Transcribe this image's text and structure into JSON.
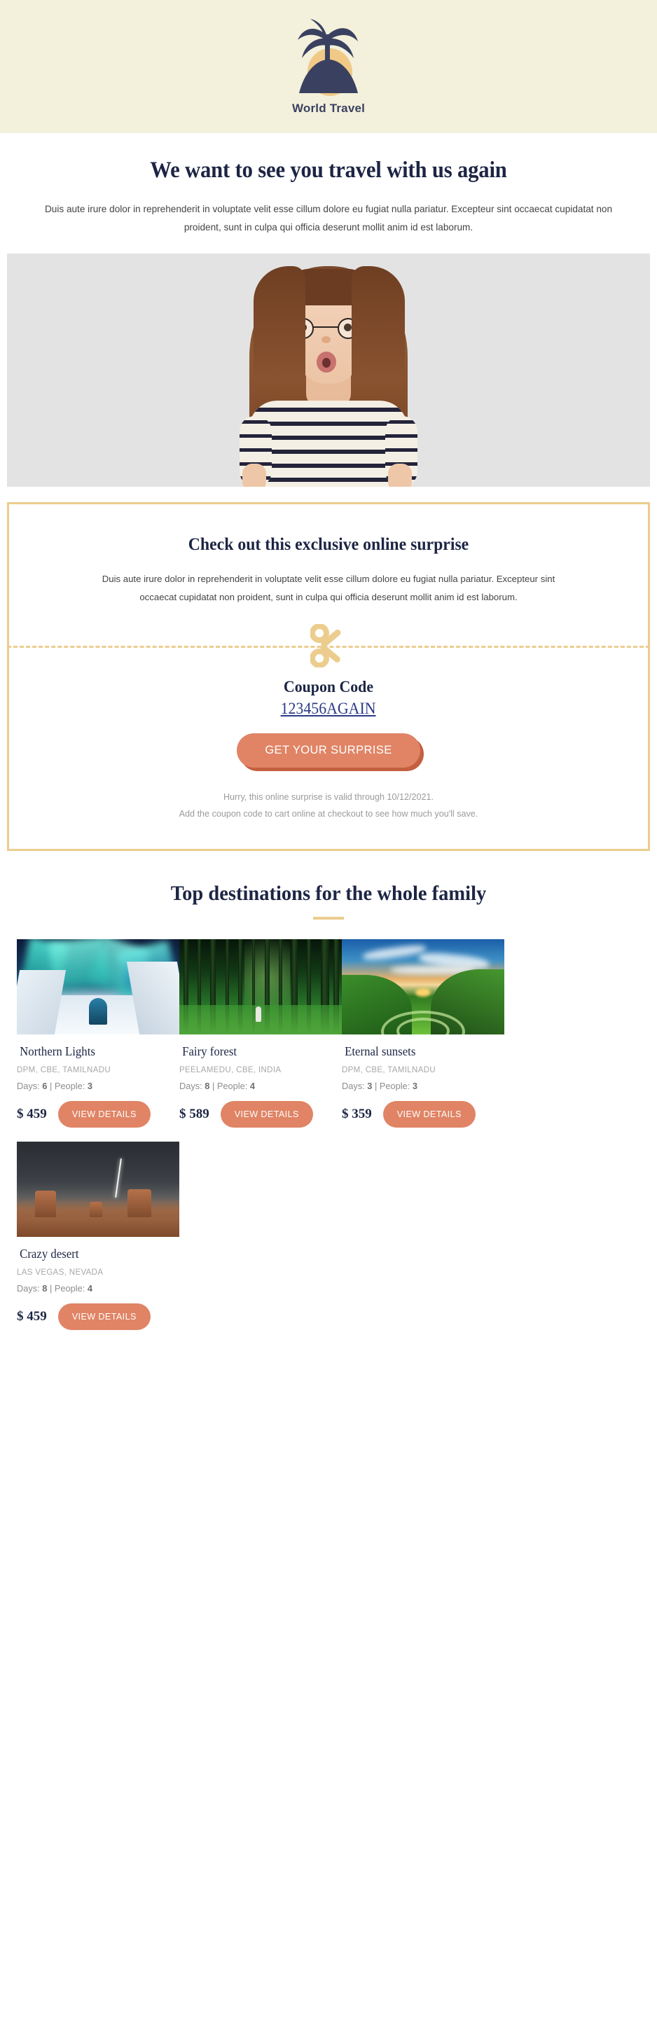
{
  "brand": {
    "name": "World Travel",
    "logo_icon": "palm-tree-island-icon",
    "header_bg": "#f3f0dc",
    "palm_color": "#3a4160",
    "sun_color": "#f0c987"
  },
  "intro": {
    "headline": "We want to see you travel with us again",
    "body": "Duis aute irure dolor in reprehenderit in voluptate velit esse cillum dolore eu fugiat nulla pariatur. Excepteur sint occaecat cupidatat non proident, sunt in culpa qui officia deserunt mollit anim id est laborum."
  },
  "hero": {
    "image_alt": "surprised-woman-pointing-down"
  },
  "coupon": {
    "title": "Check out this exclusive online surprise",
    "body": "Duis aute irure dolor in reprehenderit in voluptate velit esse cillum dolore eu fugiat nulla pariatur. Excepteur sint occaecat cupidatat non proident, sunt in culpa qui officia deserunt mollit anim id est laborum.",
    "scissors_icon": "scissors-icon",
    "code_label": "Coupon Code",
    "code_value": "123456AGAIN",
    "cta_label": "GET YOUR SURPRISE",
    "fine_print_line1": "Hurry, this online surprise is valid through 10/12/2021.",
    "fine_print_line2": "Add the coupon code to cart online at checkout to see how much you'll save.",
    "border_color": "#eccd8e",
    "accent_color": "#e08465",
    "link_color": "#2b3a87"
  },
  "destinations": {
    "title": "Top destinations for the whole family",
    "rule_color": "#eccd8e",
    "cards": [
      {
        "name": "Northern Lights",
        "location": "DPM, CBE, TAMILNADU",
        "days_label": "Days:",
        "days": "6",
        "separator": "|",
        "people_label": "People:",
        "people": "3",
        "price": "$ 459",
        "button": "VIEW DETAILS",
        "image_alt": "aurora-over-ice-hotel"
      },
      {
        "name": "Fairy forest",
        "location": "PEELAMEDU, CBE, INDIA",
        "days_label": "Days:",
        "days": "8",
        "separator": "|",
        "people_label": "People:",
        "people": "4",
        "price": "$ 589",
        "button": "VIEW DETAILS",
        "image_alt": "green-mossy-forest"
      },
      {
        "name": "Eternal sunsets",
        "location": "DPM, CBE, TAMILNADU",
        "days_label": "Days:",
        "days": "3",
        "separator": "|",
        "people_label": "People:",
        "people": "3",
        "price": "$ 359",
        "button": "VIEW DETAILS",
        "image_alt": "sunset-valley-stone-circle"
      },
      {
        "name": "Crazy desert",
        "location": "LAS VEGAS, NEVADA",
        "days_label": "Days:",
        "days": "8",
        "separator": "|",
        "people_label": "People:",
        "people": "4",
        "price": "$ 459",
        "button": "VIEW DETAILS",
        "image_alt": "desert-buttes-lightning-storm"
      }
    ]
  }
}
